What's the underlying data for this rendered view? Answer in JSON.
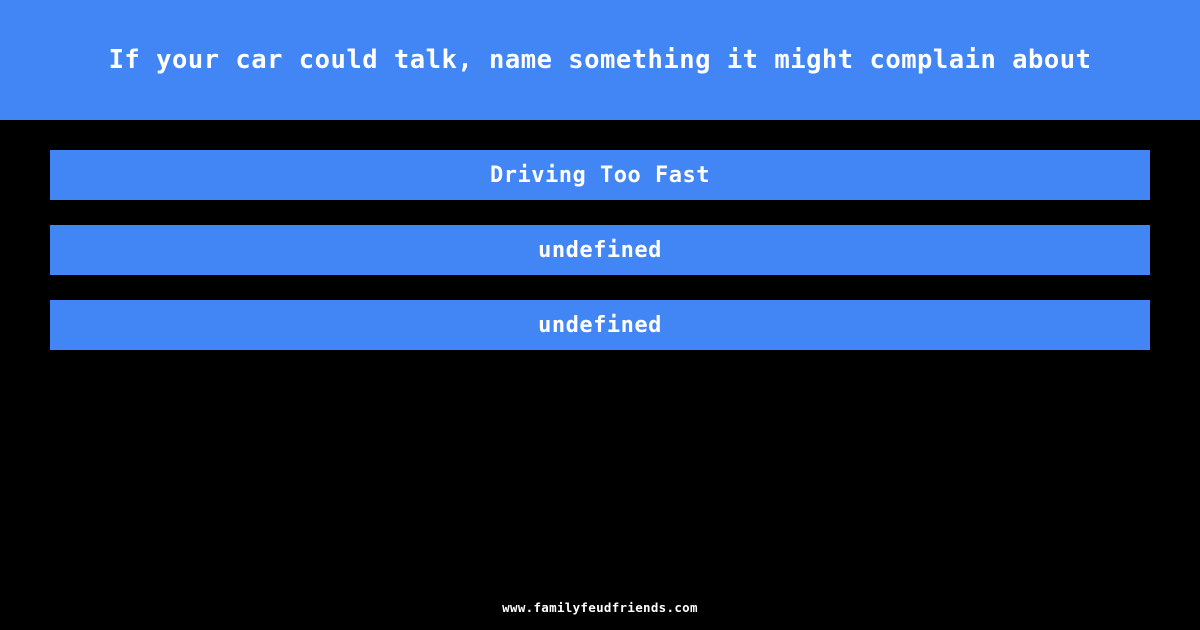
{
  "theme": {
    "background_color": "#000000",
    "accent_color": "#4285f4",
    "text_color": "#ffffff"
  },
  "header": {
    "question": "If your car could talk, name something it might complain about"
  },
  "answers": [
    {
      "text": "Driving Too Fast"
    },
    {
      "text": "undefined"
    },
    {
      "text": "undefined"
    }
  ],
  "footer": {
    "site": "www.familyfeudfriends.com"
  }
}
